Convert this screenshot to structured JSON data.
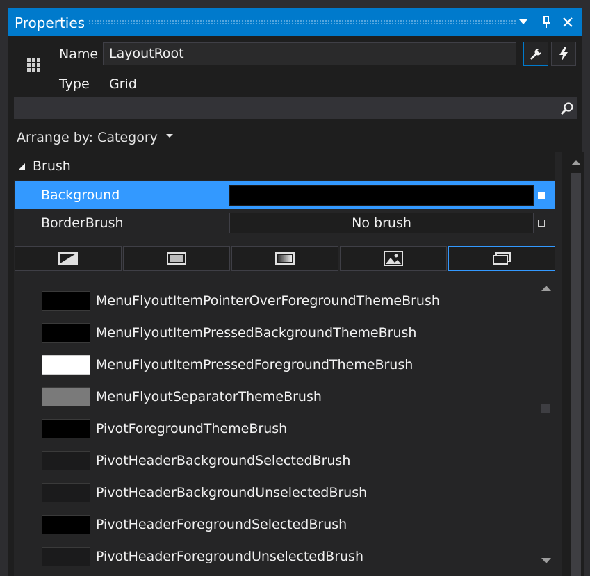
{
  "panel": {
    "title": "Properties",
    "name_label": "Name",
    "name_value": "LayoutRoot",
    "type_label": "Type",
    "type_value": "Grid",
    "search_placeholder": "",
    "arrange_label": "Arrange by: Category",
    "accent_color": "#007acc"
  },
  "brush": {
    "category_label": "Brush",
    "rows": [
      {
        "label": "Background",
        "value": "",
        "swatch": "#000000",
        "selected": true
      },
      {
        "label": "BorderBrush",
        "value": "No brush",
        "swatch": "",
        "selected": false
      }
    ],
    "tabs": [
      {
        "icon": "no-brush-icon",
        "active": false
      },
      {
        "icon": "solid-color-brush-icon",
        "active": false
      },
      {
        "icon": "gradient-brush-icon",
        "active": false
      },
      {
        "icon": "image-brush-icon",
        "active": false
      },
      {
        "icon": "brush-resources-icon",
        "active": true
      }
    ]
  },
  "resources": [
    {
      "name": "MenuFlyoutItemPointerOverForegroundThemeBrush",
      "color": "#000000"
    },
    {
      "name": "MenuFlyoutItemPressedBackgroundThemeBrush",
      "color": "#000000"
    },
    {
      "name": "MenuFlyoutItemPressedForegroundThemeBrush",
      "color": "#ffffff"
    },
    {
      "name": "MenuFlyoutSeparatorThemeBrush",
      "color": "#7a7a7a"
    },
    {
      "name": "PivotForegroundThemeBrush",
      "color": "#000000"
    },
    {
      "name": "PivotHeaderBackgroundSelectedBrush",
      "color": "#1b1b1c"
    },
    {
      "name": "PivotHeaderBackgroundUnselectedBrush",
      "color": "#1b1b1c"
    },
    {
      "name": "PivotHeaderForegroundSelectedBrush",
      "color": "#000000"
    },
    {
      "name": "PivotHeaderForegroundUnselectedBrush",
      "color": "#1b1b1c"
    }
  ]
}
